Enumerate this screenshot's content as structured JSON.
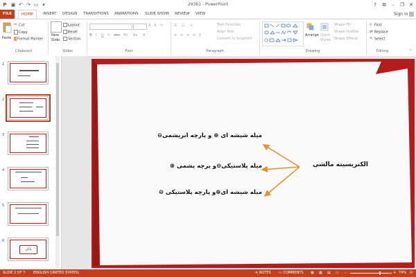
{
  "app": {
    "title": "29361 - PowerPoint",
    "sign_in": "Sign in"
  },
  "tabs": [
    "FILE",
    "HOME",
    "INSERT",
    "DESIGN",
    "TRANSITIONS",
    "ANIMATIONS",
    "SLIDE SHOW",
    "REVIEW",
    "VIEW"
  ],
  "active_tab": "HOME",
  "ribbon": {
    "clipboard": {
      "paste": "Paste",
      "cut": "Cut",
      "copy": "Copy",
      "format_painter": "Format Painter",
      "label": "Clipboard"
    },
    "slides": {
      "new_slide_1": "New",
      "new_slide_2": "Slide",
      "layout": "Layout",
      "reset": "Reset",
      "section": "Section",
      "label": "Slides"
    },
    "font": {
      "label": "Font"
    },
    "paragraph": {
      "text_direction": "Text Direction",
      "align_text": "Align Text",
      "convert_smartart": "Convert to SmartArt",
      "label": "Paragraph"
    },
    "drawing": {
      "arrange": "Arrange",
      "quick_styles_1": "Quick",
      "quick_styles_2": "Styles",
      "shape_fill": "Shape Fill",
      "shape_outline": "Shape Outline",
      "shape_effects": "Shape Effects",
      "label": "Drawing"
    },
    "editing": {
      "find": "Find",
      "replace": "Replace",
      "select": "Select",
      "label": "Editing"
    }
  },
  "thumbnails": [
    {
      "num": "1",
      "selected": false,
      "content": "title"
    },
    {
      "num": "2",
      "selected": true,
      "content": "diagram"
    },
    {
      "num": "3",
      "selected": false,
      "content": "list"
    },
    {
      "num": "4",
      "selected": false,
      "content": "formula"
    },
    {
      "num": "5",
      "selected": false,
      "content": "text"
    },
    {
      "num": "6",
      "selected": false,
      "content": "end",
      "end_label": "پایان"
    }
  ],
  "slide": {
    "center_label": "الکتریسیته مالشی",
    "lines": [
      {
        "text": "میله شیشه ای ⊕ و پارچه ابریشمی⊖"
      },
      {
        "text": "میله پلاستیکی⊖و پرچه پشمی ⊕"
      },
      {
        "text": "میله شیشه ای⊕و پارچه پلاستیکی ⊖"
      }
    ],
    "arrow_color": "#e8922e",
    "frame_color": "#b71c1c"
  },
  "status": {
    "slide": "SLIDE 2 OF 7",
    "language": "ENGLISH (UNITED STATES)",
    "notes": "NOTES",
    "comments": "COMMENTS",
    "zoom": "74%"
  },
  "colors": {
    "accent": "#c43e1c"
  }
}
